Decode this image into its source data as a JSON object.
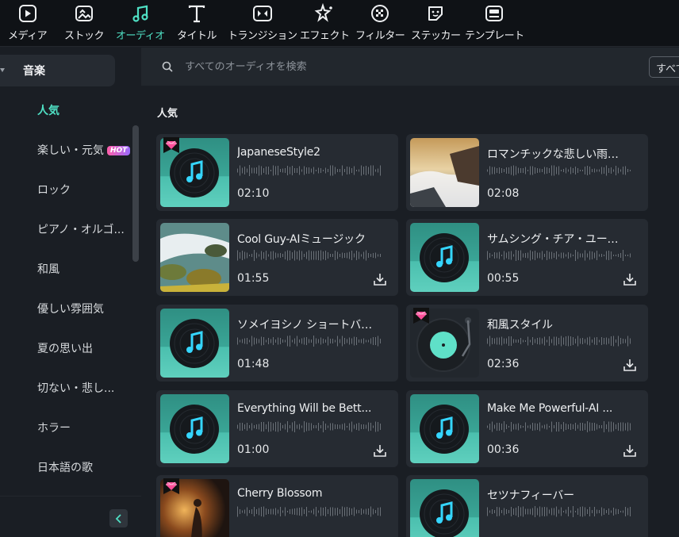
{
  "toolbar": [
    {
      "label": "メディア",
      "icon": "media-icon"
    },
    {
      "label": "ストック",
      "icon": "stock-icon"
    },
    {
      "label": "オーディオ",
      "icon": "music-note-icon"
    },
    {
      "label": "タイトル",
      "icon": "title-t-icon"
    },
    {
      "label": "トランジション",
      "icon": "transition-icon"
    },
    {
      "label": "エフェクト",
      "icon": "effect-sparkle-icon"
    },
    {
      "label": "フィルター",
      "icon": "filter-icon"
    },
    {
      "label": "ステッカー",
      "icon": "sticker-icon"
    },
    {
      "label": "テンプレート",
      "icon": "template-icon"
    }
  ],
  "active_tool": "オーディオ",
  "accent_color": "#4fe0c4",
  "sidebar": {
    "category": "音楽",
    "items": [
      {
        "label": "人気"
      },
      {
        "label": "楽しい・元気",
        "badge": "HOT"
      },
      {
        "label": "ロック"
      },
      {
        "label": "ピアノ・オルゴ..."
      },
      {
        "label": "和風"
      },
      {
        "label": "優しい雰囲気"
      },
      {
        "label": "夏の思い出"
      },
      {
        "label": "切ない・悲し..."
      },
      {
        "label": "ホラー"
      },
      {
        "label": "日本語の歌"
      }
    ],
    "collapse_icon": "chevron-left-icon"
  },
  "search": {
    "placeholder": "すべてのオーディオを検索",
    "filter_label": "すべて"
  },
  "section_title": "人気",
  "tracks": [
    {
      "title": "JapaneseStyle2",
      "duration": "02:10",
      "premium": true,
      "download": false,
      "thumb": "vinyl"
    },
    {
      "title": "ロマンチックな悲しい雨の日",
      "duration": "02:08",
      "premium": false,
      "download": false,
      "thumb": "photo-rocks"
    },
    {
      "title": "Cool Guy-AIミュージック",
      "duration": "01:55",
      "premium": false,
      "download": true,
      "thumb": "photo-stream"
    },
    {
      "title": "サムシング・チア・ユー・アッ...",
      "duration": "00:55",
      "premium": false,
      "download": true,
      "thumb": "vinyl"
    },
    {
      "title": "ソメイヨシノ ショートバージョ...",
      "duration": "01:48",
      "premium": false,
      "download": false,
      "thumb": "vinyl"
    },
    {
      "title": "和風スタイル",
      "duration": "02:36",
      "premium": true,
      "download": true,
      "thumb": "turntable"
    },
    {
      "title": "Everything Will be Bett...",
      "duration": "01:00",
      "premium": false,
      "download": true,
      "thumb": "vinyl"
    },
    {
      "title": "Make Me Powerful-AI ...",
      "duration": "00:36",
      "premium": false,
      "download": true,
      "thumb": "vinyl"
    },
    {
      "title": "Cherry Blossom",
      "duration": "",
      "premium": true,
      "download": false,
      "thumb": "photo-sunset"
    },
    {
      "title": "セツナフィーバー",
      "duration": "",
      "premium": false,
      "download": false,
      "thumb": "vinyl"
    }
  ]
}
